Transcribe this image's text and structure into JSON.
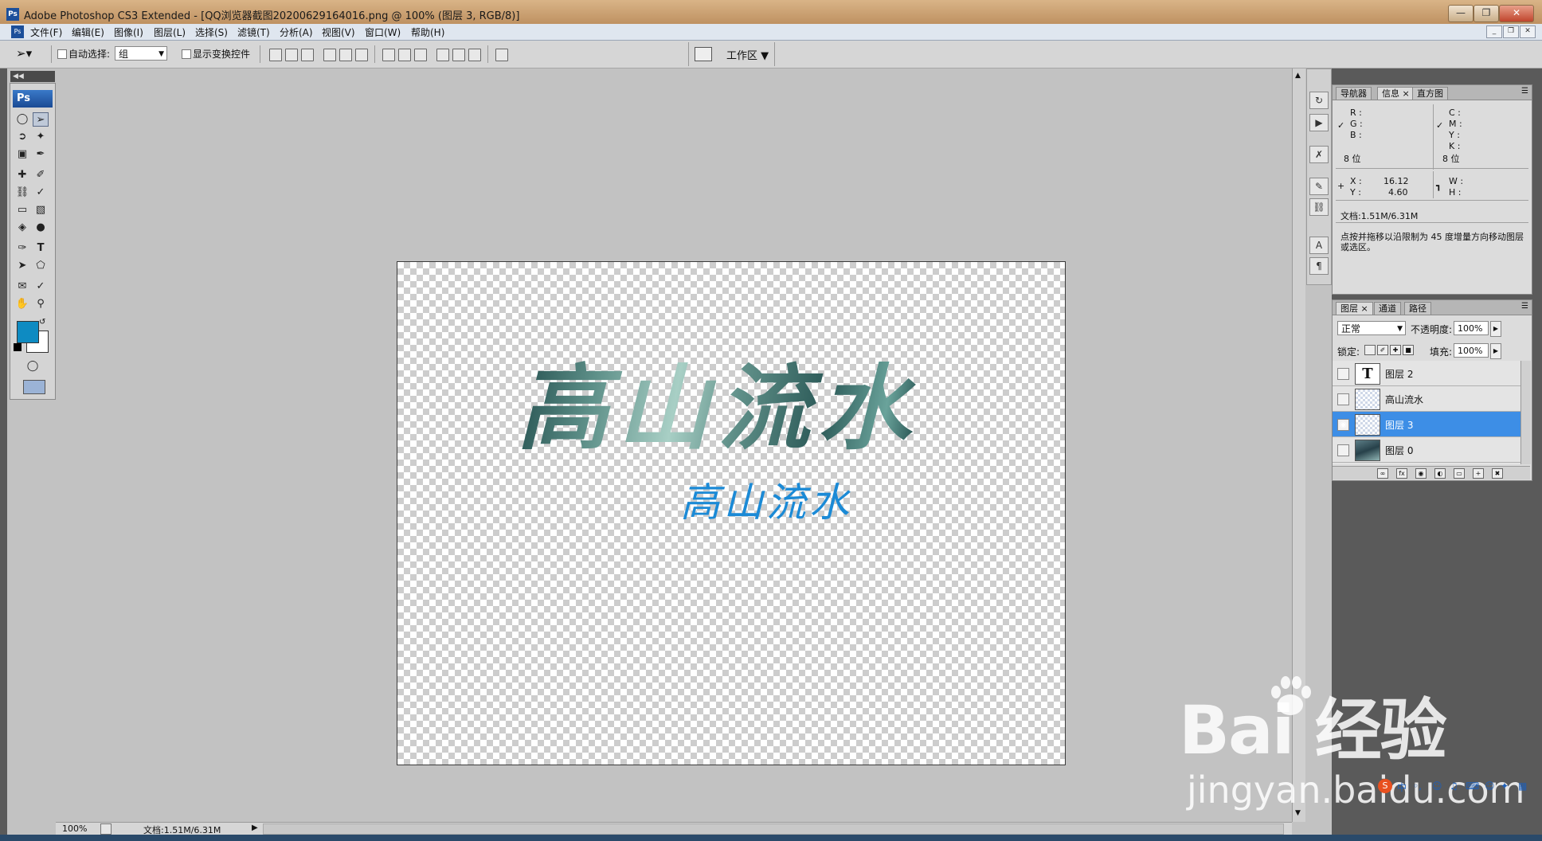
{
  "window": {
    "title": "Adobe Photoshop CS3 Extended - [QQ浏览器截图20200629164016.png @ 100% (图层 3, RGB/8)]",
    "app_badge": "Ps",
    "controls": [
      "minimize",
      "restore",
      "close"
    ]
  },
  "menu": [
    "文件(F)",
    "编辑(E)",
    "图像(I)",
    "图层(L)",
    "选择(S)",
    "滤镜(T)",
    "分析(A)",
    "视图(V)",
    "窗口(W)",
    "帮助(H)"
  ],
  "options": {
    "auto_select_label": "自动选择:",
    "auto_select_value": "组",
    "show_transform_label": "显示变换控件",
    "workspace_label": "工作区 ▼"
  },
  "toolbox": {
    "logo": "Ps",
    "fg_color": "#0e8bc2",
    "bg_color": "#ffffff"
  },
  "canvas": {
    "big_text": "高山流水",
    "small_text": "高山流水",
    "small_text_color": "#1b8ad6"
  },
  "status": {
    "zoom": "100%",
    "doc": "文档:1.51M/6.31M"
  },
  "info_panel": {
    "tabs": [
      "导航器",
      "信息",
      "直方图"
    ],
    "active_tab": "信息",
    "rgb_labels": [
      "R :",
      "G :",
      "B :"
    ],
    "cmyk_labels": [
      "C :",
      "M :",
      "Y :",
      "K :"
    ],
    "bits_left": "8 位",
    "bits_right": "8 位",
    "x_label": "X :",
    "x_value": "16.12",
    "y_label": "Y :",
    "y_value": "4.60",
    "w_label": "W :",
    "h_label": "H :",
    "doc": "文档:1.51M/6.31M",
    "hint": "点按并拖移以沿限制为 45 度增量方向移动图层或选区。"
  },
  "layers_panel": {
    "tabs": [
      "图层",
      "通道",
      "路径"
    ],
    "active_tab": "图层",
    "blend_mode": "正常",
    "opacity_label": "不透明度:",
    "opacity_value": "100%",
    "lock_label": "锁定:",
    "fill_label": "填充:",
    "fill_value": "100%",
    "layers": [
      {
        "name": "图层 2",
        "type": "text",
        "visible": false,
        "selected": false
      },
      {
        "name": "高山流水",
        "type": "transparent",
        "visible": false,
        "selected": false
      },
      {
        "name": "图层 3",
        "type": "transparent",
        "visible": true,
        "selected": true
      },
      {
        "name": "图层 0",
        "type": "photo",
        "visible": false,
        "selected": false
      }
    ]
  },
  "watermark": {
    "line1": "Bai  经验",
    "line2": "jingyan.baidu.com"
  }
}
